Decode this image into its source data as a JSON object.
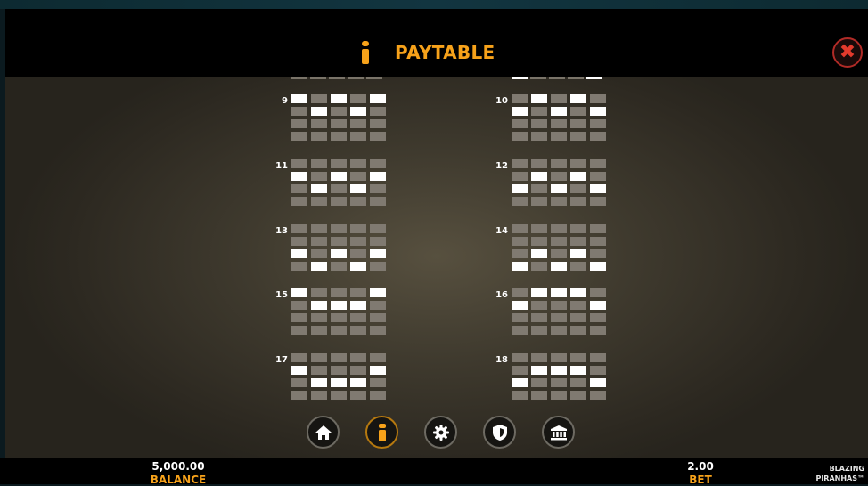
{
  "header": {
    "title": "PAYTABLE",
    "info_icon": "info-icon",
    "close_icon": "close-icon"
  },
  "paylines": [
    {
      "number": "9",
      "rows": [
        [
          1,
          0,
          1,
          0,
          1
        ],
        [
          0,
          1,
          0,
          1,
          0
        ],
        [
          0,
          0,
          0,
          0,
          0
        ],
        [
          0,
          0,
          0,
          0,
          0
        ]
      ]
    },
    {
      "number": "10",
      "rows": [
        [
          0,
          1,
          0,
          1,
          0
        ],
        [
          1,
          0,
          1,
          0,
          1
        ],
        [
          0,
          0,
          0,
          0,
          0
        ],
        [
          0,
          0,
          0,
          0,
          0
        ]
      ]
    },
    {
      "number": "11",
      "rows": [
        [
          0,
          0,
          0,
          0,
          0
        ],
        [
          1,
          0,
          1,
          0,
          1
        ],
        [
          0,
          1,
          0,
          1,
          0
        ],
        [
          0,
          0,
          0,
          0,
          0
        ]
      ]
    },
    {
      "number": "12",
      "rows": [
        [
          0,
          0,
          0,
          0,
          0
        ],
        [
          0,
          1,
          0,
          1,
          0
        ],
        [
          1,
          0,
          1,
          0,
          1
        ],
        [
          0,
          0,
          0,
          0,
          0
        ]
      ]
    },
    {
      "number": "13",
      "rows": [
        [
          0,
          0,
          0,
          0,
          0
        ],
        [
          0,
          0,
          0,
          0,
          0
        ],
        [
          1,
          0,
          1,
          0,
          1
        ],
        [
          0,
          1,
          0,
          1,
          0
        ]
      ]
    },
    {
      "number": "14",
      "rows": [
        [
          0,
          0,
          0,
          0,
          0
        ],
        [
          0,
          0,
          0,
          0,
          0
        ],
        [
          0,
          1,
          0,
          1,
          0
        ],
        [
          1,
          0,
          1,
          0,
          1
        ]
      ]
    },
    {
      "number": "15",
      "rows": [
        [
          1,
          0,
          0,
          0,
          1
        ],
        [
          0,
          1,
          1,
          1,
          0
        ],
        [
          0,
          0,
          0,
          0,
          0
        ],
        [
          0,
          0,
          0,
          0,
          0
        ]
      ]
    },
    {
      "number": "16",
      "rows": [
        [
          0,
          1,
          1,
          1,
          0
        ],
        [
          1,
          0,
          0,
          0,
          1
        ],
        [
          0,
          0,
          0,
          0,
          0
        ],
        [
          0,
          0,
          0,
          0,
          0
        ]
      ]
    },
    {
      "number": "17",
      "rows": [
        [
          0,
          0,
          0,
          0,
          0
        ],
        [
          1,
          0,
          0,
          0,
          1
        ],
        [
          0,
          1,
          1,
          1,
          0
        ],
        [
          0,
          0,
          0,
          0,
          0
        ]
      ]
    },
    {
      "number": "18",
      "rows": [
        [
          0,
          0,
          0,
          0,
          0
        ],
        [
          0,
          1,
          1,
          1,
          0
        ],
        [
          1,
          0,
          0,
          0,
          1
        ],
        [
          0,
          0,
          0,
          0,
          0
        ]
      ]
    }
  ],
  "nav": [
    {
      "icon": "home-icon",
      "active": false
    },
    {
      "icon": "info-icon",
      "active": true
    },
    {
      "icon": "gear-icon",
      "active": false
    },
    {
      "icon": "shield-icon",
      "active": false
    },
    {
      "icon": "bank-icon",
      "active": false
    }
  ],
  "footer": {
    "balance_value": "5,000.00",
    "balance_label": "BALANCE",
    "bet_value": "2.00",
    "bet_label": "BET",
    "brand_line1": "BLAZING",
    "brand_line2": "PIRANHAS™"
  },
  "colors": {
    "accent": "#f7a21a",
    "close": "#e23a2c",
    "cell_on": "#ffffff",
    "cell_off": "#807a71"
  }
}
